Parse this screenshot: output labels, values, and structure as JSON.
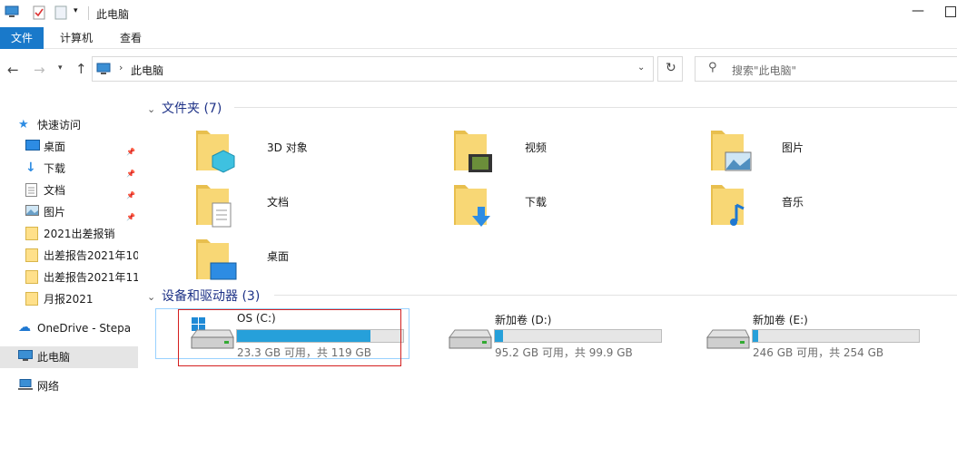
{
  "window": {
    "title": "此电脑"
  },
  "ribbon": {
    "tabs": [
      "文件",
      "计算机",
      "查看"
    ]
  },
  "address": {
    "location": "此电脑",
    "search_placeholder": "搜索\"此电脑\""
  },
  "sidebar": {
    "items": [
      {
        "label": "快速访问",
        "icon": "star-icon"
      },
      {
        "label": "桌面",
        "icon": "desktop-icon",
        "pinned": true
      },
      {
        "label": "下载",
        "icon": "download-icon",
        "pinned": true
      },
      {
        "label": "文档",
        "icon": "document-icon",
        "pinned": true
      },
      {
        "label": "图片",
        "icon": "picture-icon",
        "pinned": true
      },
      {
        "label": "2021出差报销",
        "icon": "folder-icon"
      },
      {
        "label": "出差报告2021年10",
        "icon": "folder-icon"
      },
      {
        "label": "出差报告2021年11",
        "icon": "folder-icon"
      },
      {
        "label": "月报2021",
        "icon": "folder-icon"
      },
      {
        "label": "OneDrive - Stepan",
        "icon": "cloud-icon"
      },
      {
        "label": "此电脑",
        "icon": "computer-icon",
        "selected": true
      },
      {
        "label": "网络",
        "icon": "network-icon"
      }
    ]
  },
  "folders": {
    "header": "文件夹 (7)",
    "items": [
      {
        "name": "3D 对象",
        "icon": "3d-objects-folder-icon"
      },
      {
        "name": "视频",
        "icon": "videos-folder-icon"
      },
      {
        "name": "图片",
        "icon": "pictures-folder-icon"
      },
      {
        "name": "文档",
        "icon": "documents-folder-icon"
      },
      {
        "name": "下载",
        "icon": "downloads-folder-icon"
      },
      {
        "name": "音乐",
        "icon": "music-folder-icon"
      },
      {
        "name": "桌面",
        "icon": "desktop-folder-icon"
      }
    ]
  },
  "drives": {
    "header": "设备和驱动器 (3)",
    "items": [
      {
        "name": "OS (C:)",
        "usage": "23.3 GB 可用，共 119 GB",
        "used_fraction": 0.804,
        "icon": "windows-drive-icon"
      },
      {
        "name": "新加卷 (D:)",
        "usage": "95.2 GB 可用，共 99.9 GB",
        "used_fraction": 0.047,
        "icon": "drive-icon"
      },
      {
        "name": "新加卷 (E:)",
        "usage": "246 GB 可用，共 254 GB",
        "used_fraction": 0.031,
        "icon": "drive-icon"
      }
    ]
  },
  "colors": {
    "accent": "#1979ca",
    "drive_fill": "#26a0da",
    "highlight": "#d41f1f"
  }
}
